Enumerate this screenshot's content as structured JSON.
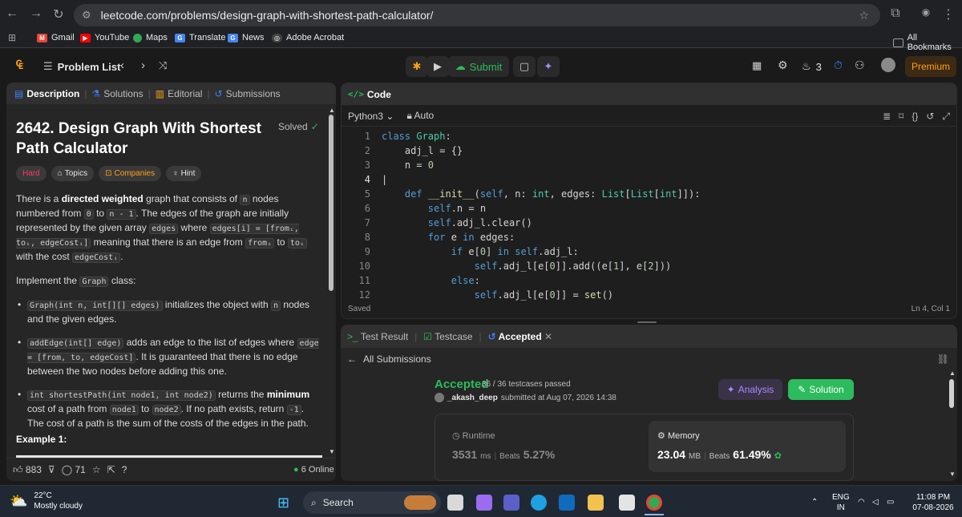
{
  "browser": {
    "url": "leetcode.com/problems/design-graph-with-shortest-path-calculator/",
    "bookmarks": [
      "Gmail",
      "YouTube",
      "Maps",
      "Translate",
      "News",
      "Adobe Acrobat"
    ],
    "all_bookmarks": "All Bookmarks"
  },
  "topbar": {
    "problem_list": "Problem List",
    "submit": "Submit",
    "streak": "3",
    "premium": "Premium"
  },
  "left": {
    "tabs": [
      "Description",
      "Solutions",
      "Editorial",
      "Submissions"
    ],
    "title": "2642. Design Graph With Shortest Path Calculator",
    "solved": "Solved",
    "tags": [
      "Hard",
      "Topics",
      "Companies",
      "Hint"
    ],
    "example": "Example 1:",
    "likes": "883",
    "comments": "71",
    "online": "6 Online"
  },
  "code": {
    "header": "Code",
    "language": "Python3",
    "mode": "Auto",
    "status": "Saved",
    "position": "Ln 4, Col 1",
    "lines": [
      "class Graph:",
      "    adj_l = {}",
      "    n = 0",
      "",
      "    def __init__(self, n: int, edges: List[List[int]]):",
      "        self.n = n",
      "        self.adj_l.clear()",
      "        for e in edges:",
      "            if e[0] in self.adj_l:",
      "                self.adj_l[e[0]].add((e[1], e[2]))",
      "            else:",
      "                self.adj_l[e[0]] = set()"
    ]
  },
  "result": {
    "tabs": [
      "Test Result",
      "Testcase",
      "Accepted"
    ],
    "all_submissions": "All Submissions",
    "status": "Accepted",
    "passed": "36 / 36 testcases passed",
    "user": "_akash_deep",
    "submitted_at": "submitted at Aug 07, 2026 14:38",
    "analysis": "Analysis",
    "solution": "Solution",
    "runtime_label": "Runtime",
    "runtime_value": "3531",
    "runtime_unit": "ms",
    "runtime_beats_label": "Beats",
    "runtime_beats": "5.27%",
    "memory_label": "Memory",
    "memory_value": "23.04",
    "memory_unit": "MB",
    "memory_beats_label": "Beats",
    "memory_beats": "61.49%"
  },
  "taskbar": {
    "temp": "22°C",
    "weather": "Mostly cloudy",
    "search": "Search",
    "lang1": "ENG",
    "lang2": "IN",
    "time": "11:08 PM",
    "date": "07-08-2026"
  }
}
